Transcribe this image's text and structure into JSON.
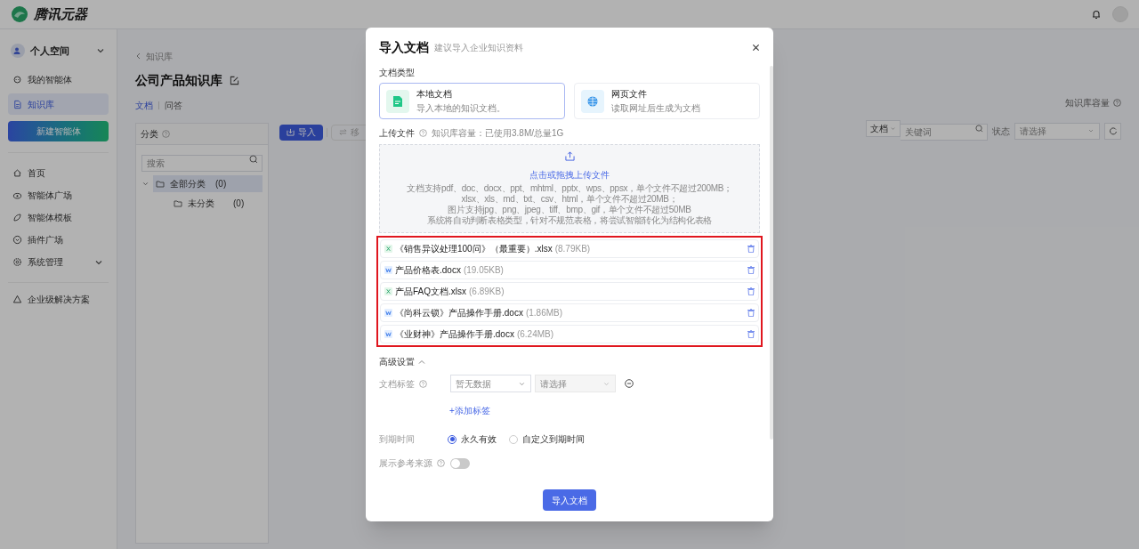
{
  "header": {
    "brand": "腾讯元器"
  },
  "sidebar": {
    "space": "个人空间",
    "top_items": [
      {
        "label": "我的智能体",
        "selected": false
      },
      {
        "label": "知识库",
        "selected": true
      }
    ],
    "create_button": "新建智能体",
    "nav_items": [
      {
        "label": "首页",
        "expandable": false
      },
      {
        "label": "智能体广场",
        "expandable": false
      },
      {
        "label": "智能体模板",
        "expandable": false
      },
      {
        "label": "插件广场",
        "expandable": false
      },
      {
        "label": "系统管理",
        "expandable": true
      }
    ],
    "bottom_item": "企业级解决方案"
  },
  "main": {
    "breadcrumb": "知识库",
    "title": "公司产品知识库",
    "tabs": [
      {
        "label": "文档",
        "selected": true
      },
      {
        "label": "问答",
        "selected": false
      }
    ],
    "capacity_label": "知识库容量",
    "category_panel": {
      "title": "分类",
      "search_placeholder": "搜索",
      "tree": [
        {
          "label": "全部分类",
          "count": "(0)",
          "selected": true,
          "children": [
            {
              "label": "未分类",
              "count": "(0)",
              "selected": false
            }
          ]
        }
      ]
    },
    "toolbar": {
      "import_button": "导入",
      "move_button": "移"
    },
    "filters": {
      "type_select": "文档",
      "keyword_placeholder": "关键词",
      "status_label": "状态",
      "status_placeholder": "请选择"
    }
  },
  "modal": {
    "title": "导入文档",
    "subtitle": "建议导入企业知识资料",
    "doc_type_label": "文档类型",
    "doc_types": [
      {
        "kind": "local",
        "title": "本地文档",
        "desc": "导入本地的知识文档。",
        "selected": true
      },
      {
        "kind": "web",
        "title": "网页文件",
        "desc": "读取网址后生成为文档",
        "selected": false
      }
    ],
    "upload_label": "上传文件",
    "capacity_note": "知识库容量：已使用3.8M/总量1G",
    "dropzone": {
      "action": "点击或拖拽上传文件",
      "lines": [
        "文档支持pdf、doc、docx、ppt、mhtml、pptx、wps、ppsx，单个文件不超过200MB；",
        "xlsx、xls、md、txt、csv、html，单个文件不超过20MB；",
        "图片支持jpg、png、jpeg、tiff、bmp、gif，单个文件不超过50MB",
        "系统将自动判断表格类型，针对不规范表格，将尝试智能转化为结构化表格"
      ]
    },
    "files": [
      {
        "kind": "excel",
        "name": "《销售异议处理100问》（最重要）.xlsx",
        "size": "(8.79KB)"
      },
      {
        "kind": "word",
        "name": "产品价格表.docx",
        "size": "(19.05KB)"
      },
      {
        "kind": "excel",
        "name": "产品FAQ文档.xlsx",
        "size": "(6.89KB)"
      },
      {
        "kind": "word",
        "name": "《尚科云锁》产品操作手册.docx",
        "size": "(1.86MB)"
      },
      {
        "kind": "word",
        "name": "《业财神》产品操作手册.docx",
        "size": "(6.24MB)"
      }
    ],
    "advanced_label": "高级设置",
    "tag_label": "文档标签",
    "tag_select": "暂无数据",
    "tag_value_placeholder": "请选择",
    "add_tag": "+添加标签",
    "expiry_label": "到期时间",
    "expiry_options": [
      {
        "label": "永久有效",
        "selected": true
      },
      {
        "label": "自定义到期时间",
        "selected": false
      }
    ],
    "source_label": "展示参考来源",
    "source_on": false,
    "submit": "导入文档"
  }
}
